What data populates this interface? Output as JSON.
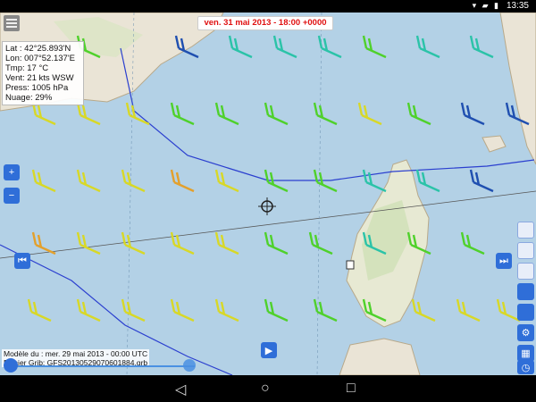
{
  "statusbar": {
    "time": "13:35",
    "icons": "▾ ▰ ▮"
  },
  "forecast_date": "ven. 31 mai 2013 - 18:00 +0000",
  "info": {
    "lat": "Lat :  42°25.893'N",
    "lon": "Lon: 007°52.137'E",
    "tmp": "Tmp:  17 °C",
    "wind": "Vent:  21 kts  WSW",
    "press": "Press: 1005 hPa",
    "cloud": "Nuage: 29%"
  },
  "footer": {
    "model": "Modèle du : mer. 29 mai 2013 - 00:00 UTC",
    "file": "Fichier Grib: GFS20130529070601884.grb"
  },
  "buttons": {
    "zoom_in": "+",
    "zoom_out": "−",
    "prev": "⏮",
    "next": "⏭",
    "play": "▶",
    "settings": "⚙",
    "calendar": "▦",
    "clock": "◷"
  },
  "colors": {
    "sea": "#b3d1e6",
    "land": "#eae4d6",
    "wind_yellow": "#d8d827",
    "wind_green": "#4fd12b",
    "wind_teal": "#2bc3a8",
    "wind_blue": "#1f4fb0",
    "wind_orange": "#e3a02c",
    "route": "#2b3fcf"
  },
  "navbar": {
    "back": "◁",
    "home": "○",
    "recent": "□"
  }
}
